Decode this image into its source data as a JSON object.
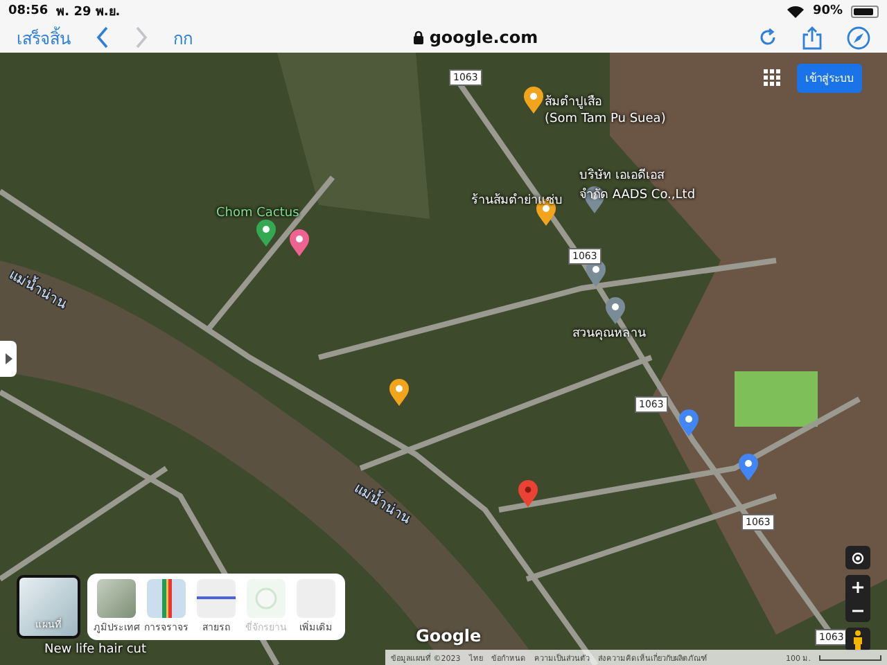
{
  "status_bar": {
    "time": "08:56",
    "date": "พ. 29 พ.ย.",
    "battery": "90%"
  },
  "toolbar": {
    "done": "เสร็จสิ้น",
    "back_disabled": false,
    "forward_disabled": true,
    "text_size": "กก",
    "url": "google.com"
  },
  "map": {
    "login": "เข้าสู่ระบบ",
    "labels": [
      {
        "text": "ส้มตำปูเสือ",
        "kind": "place"
      },
      {
        "text": "(Som Tam Pu Suea)",
        "kind": "place"
      },
      {
        "text": "บริษัท เอเอดีเอส",
        "kind": "place"
      },
      {
        "text": "จำกัด AADS Co.,Ltd",
        "kind": "place"
      },
      {
        "text": "ร้านส้มตำย่าแซ่บ",
        "kind": "place"
      },
      {
        "text": "สวนคุณหลาน",
        "kind": "place"
      },
      {
        "text": "Chom Cactus",
        "kind": "park"
      },
      {
        "text": "แม่น้ำน่าน",
        "kind": "river"
      },
      {
        "text": "แม่น้ำน่าน",
        "kind": "river"
      },
      {
        "text": "New life hair cut",
        "kind": "place"
      }
    ],
    "markers": [
      {
        "kind": "food",
        "color": "#f2a51c"
      },
      {
        "kind": "food",
        "color": "#f2a51c"
      },
      {
        "kind": "food",
        "color": "#f2a51c"
      },
      {
        "kind": "place",
        "color": "#7b8c99"
      },
      {
        "kind": "place",
        "color": "#7b8c99"
      },
      {
        "kind": "place",
        "color": "#7b8c99"
      },
      {
        "kind": "park",
        "color": "#34a853"
      },
      {
        "kind": "hotel",
        "color": "#f06292"
      },
      {
        "kind": "shop",
        "color": "#4285f4"
      },
      {
        "kind": "shop",
        "color": "#4285f4"
      },
      {
        "kind": "dropped",
        "color": "#ea4335"
      }
    ],
    "road_shields": [
      "1063",
      "1063",
      "1063",
      "1063",
      "1063"
    ],
    "layers": {
      "thumbnail": "แผนที่",
      "options": [
        {
          "label": "ภูมิประเทศ",
          "disabled": false
        },
        {
          "label": "การจราจร",
          "disabled": false
        },
        {
          "label": "สายรถ",
          "disabled": false
        },
        {
          "label": "ขี่จักรยาน",
          "disabled": true
        },
        {
          "label": "เพิ่มเติม",
          "disabled": false
        }
      ]
    },
    "logo": "Google",
    "attribution": [
      "ข้อมูลแผนที่ ©2023",
      "ไทย",
      "ข้อกำหนด",
      "ความเป็นส่วนตัว",
      "ส่งความคิดเห็นเกี่ยวกับผลิตภัณฑ์"
    ],
    "scale": "100 ม."
  }
}
